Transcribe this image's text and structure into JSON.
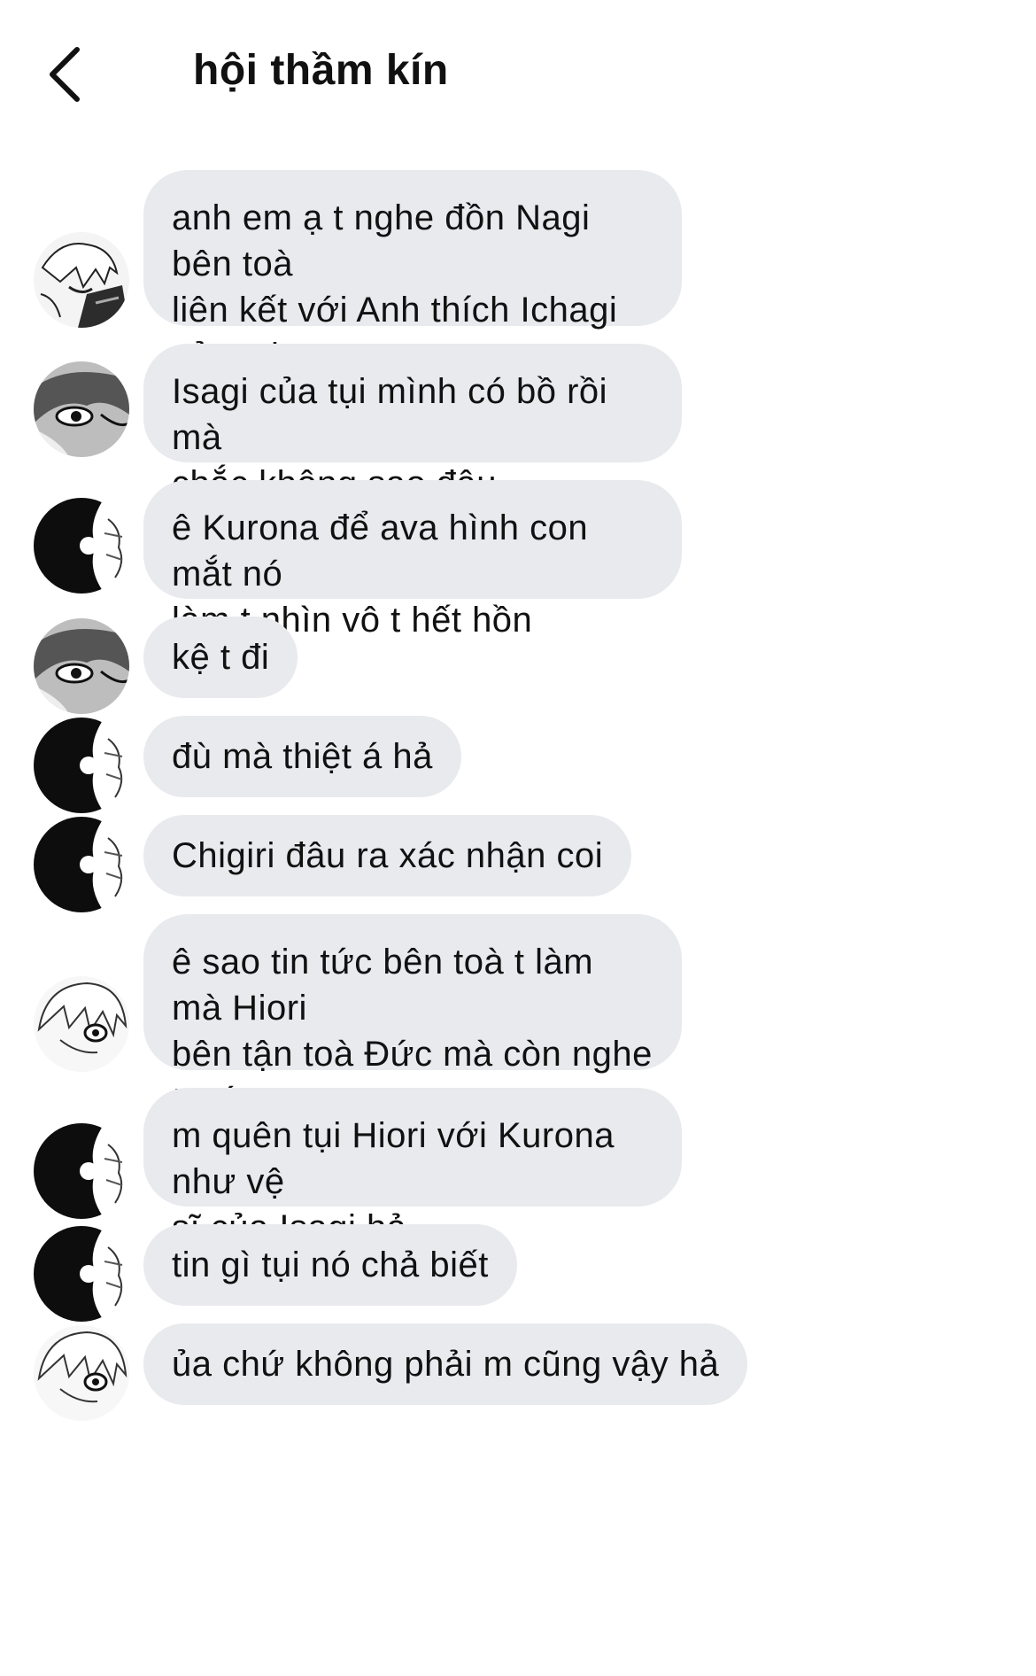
{
  "header": {
    "back_icon": "chevron-left-icon",
    "title": "hội thầm kín"
  },
  "colors": {
    "bubble": "#e9eaee",
    "background": "#ffffff",
    "text": "#111111"
  },
  "messages": [
    {
      "avatar": "avatar-nagi",
      "text": "anh em ạ t nghe đồn Nagi bên toà\nliên kết với Anh thích Ichagi của tụi\nmình"
    },
    {
      "avatar": "avatar-chigiri",
      "text": "Isagi của tụi mình có bồ rồi mà\nchắc không sao đâu"
    },
    {
      "avatar": "avatar-dark",
      "text": "ê Kurona để ava hình con mắt nó\nlàm t nhìn vô t hết hồn"
    },
    {
      "avatar": "avatar-chigiri",
      "text": "kệ t đi"
    },
    {
      "avatar": "avatar-dark",
      "text": "đù mà thiệt á hả"
    },
    {
      "avatar": "avatar-dark",
      "text": "Chigiri đâu ra xác nhận coi"
    },
    {
      "avatar": "avatar-hiori",
      "text": "ê sao tin tức bên toà t làm mà Hiori\nbên tận toà Đức mà còn nghe trước\ncả t v"
    },
    {
      "avatar": "avatar-dark",
      "text": "m quên tụi Hiori với Kurona như vệ\nsĩ của Isagi hả"
    },
    {
      "avatar": "avatar-dark",
      "text": "tin gì tụi nó chả biết"
    },
    {
      "avatar": "avatar-hiori",
      "text": "ủa chứ không phải m cũng vậy hả"
    }
  ]
}
